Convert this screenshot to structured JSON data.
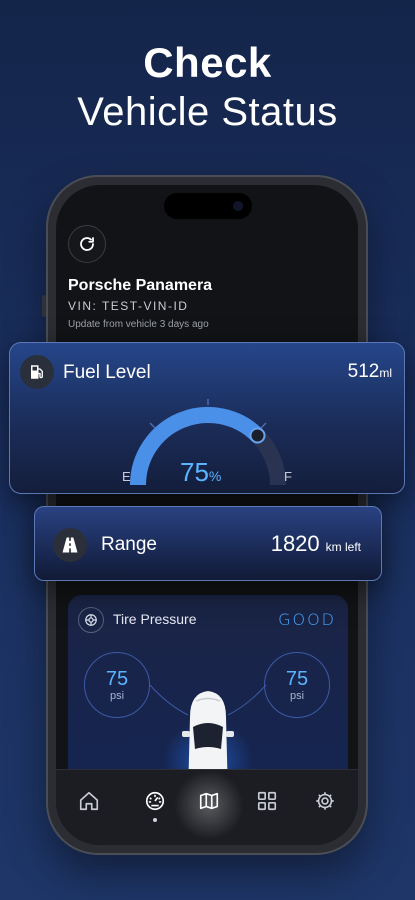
{
  "headline": {
    "line1": "Check",
    "line2": "Vehicle Status"
  },
  "vehicle": {
    "name": "Porsche Panamera",
    "vin": "VIN: TEST-VIN-ID",
    "update_text": "Update from vehicle 3 days ago"
  },
  "fuel": {
    "title": "Fuel Level",
    "amount": "512",
    "amount_unit": "ml",
    "percent": 75,
    "percent_text": "75",
    "percent_unit": "%",
    "empty_label": "E",
    "full_label": "F"
  },
  "range": {
    "title": "Range",
    "value": "1820",
    "unit": "km left"
  },
  "tire": {
    "title": "Tire Pressure",
    "status": "GOOD",
    "left": {
      "value": "75",
      "unit": "psi"
    },
    "right": {
      "value": "75",
      "unit": "psi"
    }
  },
  "nav": {
    "items": [
      "home-icon",
      "gauge-icon",
      "map-icon",
      "grid-icon",
      "gear-icon"
    ],
    "active_index": 1
  },
  "colors": {
    "accent": "#4aa6ff",
    "background": "#1a2f5e"
  }
}
